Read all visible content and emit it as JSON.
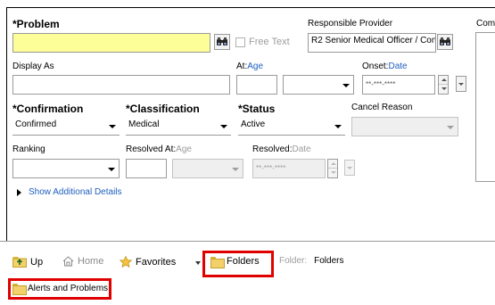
{
  "form": {
    "problem_label": "*Problem",
    "problem_value": "",
    "free_text_label": "Free Text",
    "responsible_provider_label": "Responsible Provider",
    "responsible_provider_value": "R2 Senior Medical Officer / Con",
    "comments_label": "Comr",
    "display_as_label": "Display As",
    "at_label": "At:",
    "at_link": "Age",
    "onset_label": "Onset:",
    "onset_link": "Date",
    "onset_placeholder": "**-***-****",
    "confirmation_label": "*Confirmation",
    "confirmation_value": "Confirmed",
    "classification_label": "*Classification",
    "classification_value": "Medical",
    "status_label": "*Status",
    "status_value": "Active",
    "cancel_reason_label": "Cancel Reason",
    "ranking_label": "Ranking",
    "resolved_at_label": "Resolved At:",
    "resolved_at_link": "Age",
    "resolved_label": "Resolved:",
    "resolved_link": "Date",
    "resolved_placeholder": "**-***-****",
    "show_additional_details": "Show Additional Details"
  },
  "toolbar": {
    "up_label": "Up",
    "home_label": "Home",
    "favorites_label": "Favorites",
    "folders_label": "Folders",
    "folder_prefix": "Folder:",
    "folder_value": "Folders"
  },
  "folder_list": {
    "items": [
      "Alerts and Problems"
    ]
  },
  "colors": {
    "required_field_bg": "#fefe98",
    "link": "#1f5fbf",
    "highlight": "#e00000"
  }
}
